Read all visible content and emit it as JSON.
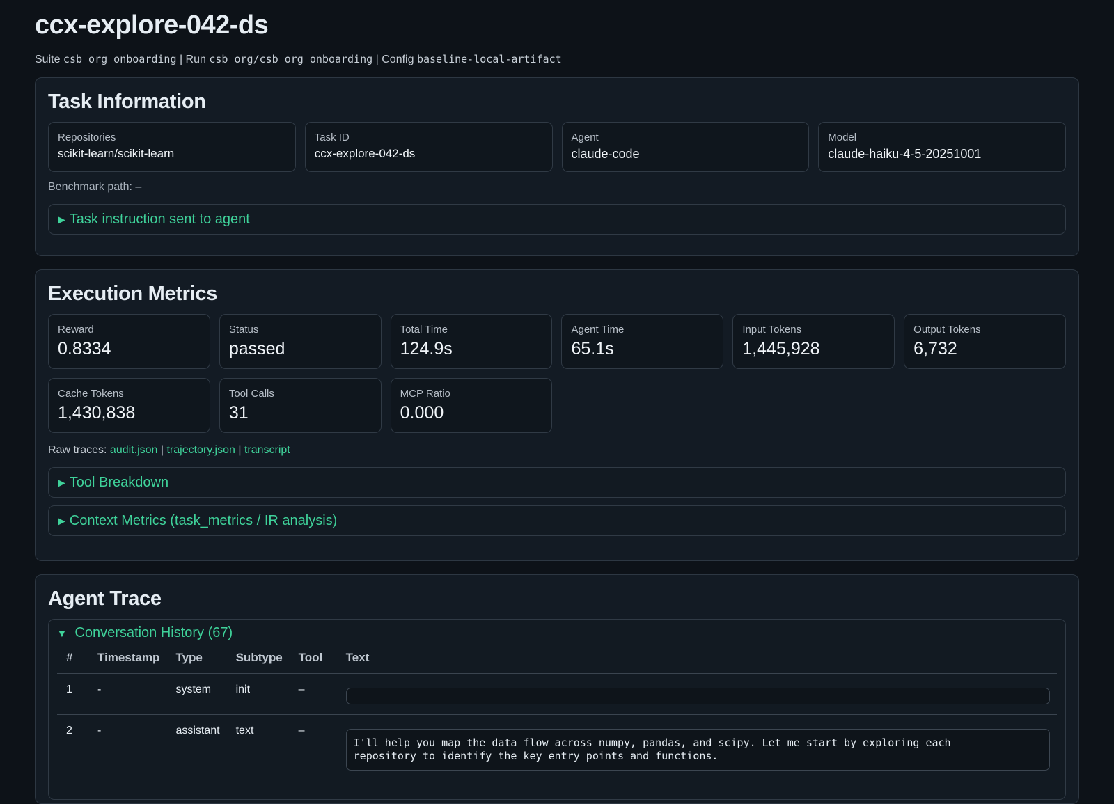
{
  "page": {
    "title": "ccx-explore-042-ds",
    "subtitle": {
      "suite_label": "Suite",
      "suite_value": "csb_org_onboarding",
      "run_label": "Run",
      "run_value": "csb_org/csb_org_onboarding",
      "config_label": "Config",
      "config_value": "baseline-local-artifact",
      "separator": "|"
    }
  },
  "task_info": {
    "heading": "Task Information",
    "cards": [
      {
        "label": "Repositories",
        "value": "scikit-learn/scikit-learn"
      },
      {
        "label": "Task ID",
        "value": "ccx-explore-042-ds"
      },
      {
        "label": "Agent",
        "value": "claude-code"
      },
      {
        "label": "Model",
        "value": "claude-haiku-4-5-20251001"
      }
    ],
    "benchmark_path": "Benchmark path: –",
    "instruction_toggle": "Task instruction sent to agent"
  },
  "execution": {
    "heading": "Execution Metrics",
    "metrics": [
      {
        "label": "Reward",
        "value": "0.8334"
      },
      {
        "label": "Status",
        "value": "passed"
      },
      {
        "label": "Total Time",
        "value": "124.9s"
      },
      {
        "label": "Agent Time",
        "value": "65.1s"
      },
      {
        "label": "Input Tokens",
        "value": "1,445,928"
      },
      {
        "label": "Output Tokens",
        "value": "6,732"
      },
      {
        "label": "Cache Tokens",
        "value": "1,430,838"
      },
      {
        "label": "Tool Calls",
        "value": "31"
      },
      {
        "label": "MCP Ratio",
        "value": "0.000"
      }
    ],
    "raw_traces_label": "Raw traces:",
    "raw_traces": [
      "audit.json",
      "trajectory.json",
      "transcript"
    ],
    "raw_traces_sep": "|",
    "tool_breakdown": "Tool Breakdown",
    "context_metrics": "Context Metrics (task_metrics / IR analysis)"
  },
  "agent_trace": {
    "heading": "Agent Trace",
    "conversation_toggle": "Conversation History (67)",
    "columns": [
      "#",
      "Timestamp",
      "Type",
      "Subtype",
      "Tool",
      "Text"
    ],
    "rows": [
      {
        "num": "1",
        "timestamp": "-",
        "type": "system",
        "subtype": "init",
        "tool": "–",
        "text": ""
      },
      {
        "num": "2",
        "timestamp": "-",
        "type": "assistant",
        "subtype": "text",
        "tool": "–",
        "text": "I'll help you map the data flow across numpy, pandas, and scipy. Let me start by exploring each\nrepository to identify the key entry points and functions."
      }
    ]
  },
  "colors": {
    "accent": "#3fd29a",
    "background": "#0d1218",
    "panel": "#131b24"
  }
}
